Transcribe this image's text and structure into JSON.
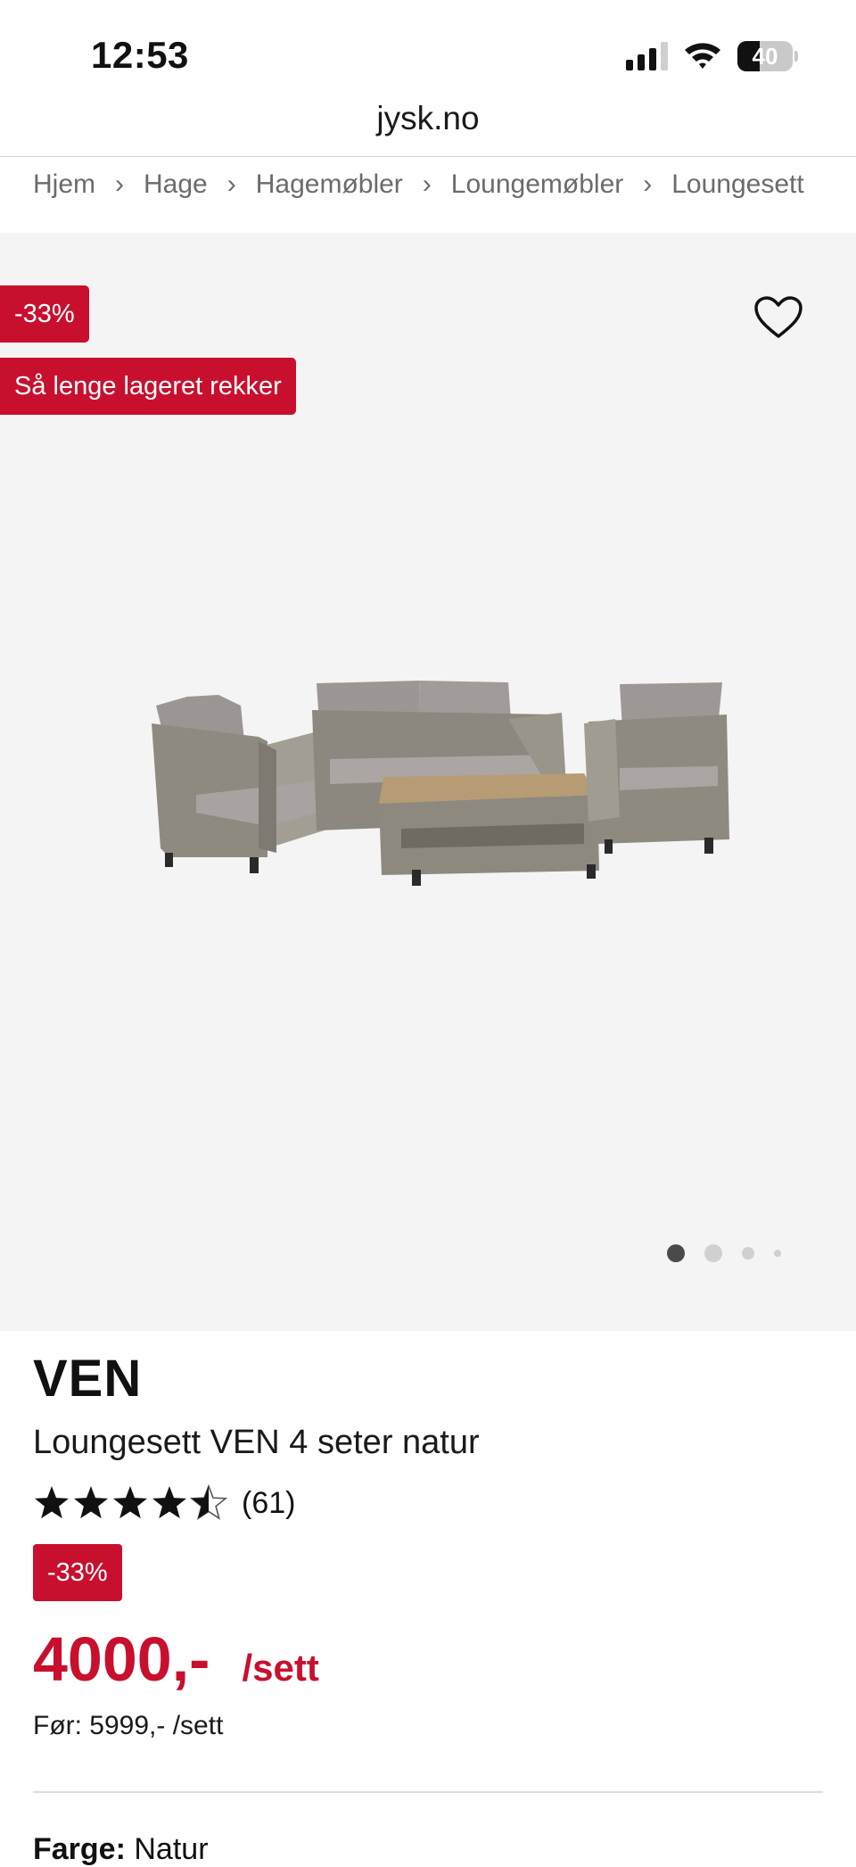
{
  "status_bar": {
    "time": "12:53",
    "battery_level": "40",
    "battery_fraction": 0.4
  },
  "browser": {
    "url": "jysk.no"
  },
  "breadcrumb": {
    "items": [
      "Hjem",
      "Hage",
      "Hagemøbler",
      "Loungemøbler",
      "Loungesett"
    ],
    "separator": "›"
  },
  "gallery": {
    "discount_badge": "-33%",
    "stock_badge": "Så lenge lageret rekker",
    "image_count": 4,
    "active_image": 1
  },
  "product": {
    "brand": "VEN",
    "name": "Loungesett VEN 4 seter natur",
    "rating": 4.5,
    "rating_max": 5,
    "review_count": "(61)",
    "discount_badge": "-33%",
    "price": "4000,-",
    "unit": "/sett",
    "before_price": "Før: 5999,- /sett",
    "color_label": "Farge:",
    "color_value": "Natur"
  },
  "colors": {
    "accent": "#c8102e",
    "gallery_background": "#f4f4f4",
    "text": "#111111"
  },
  "icons": {
    "favorite": "heart-outline-icon",
    "breadcrumb_separator": "chevron-right-icon",
    "star": "star-icon"
  }
}
